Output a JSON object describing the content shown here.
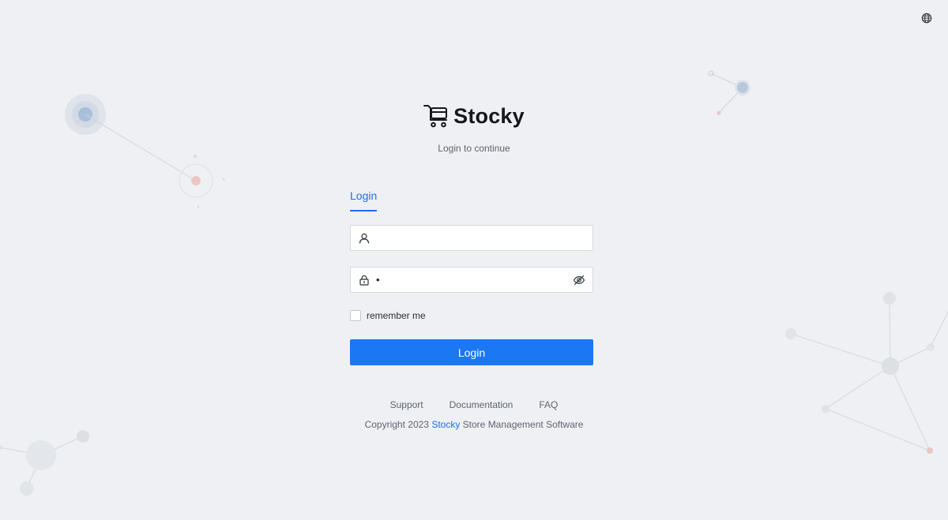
{
  "header": {
    "language_icon": "globe-icon"
  },
  "brand": {
    "logo_icon": "shopping-cart-icon",
    "name": "Stocky",
    "subtitle": "Login to continue"
  },
  "login_form": {
    "tab_label": "Login",
    "username": {
      "icon": "user-icon",
      "value": "",
      "placeholder": ""
    },
    "password": {
      "icon": "lock-icon",
      "value": "•",
      "placeholder": "",
      "toggle_icon": "eye-slash-icon"
    },
    "remember_label": "remember me",
    "remember_checked": false,
    "submit_label": "Login"
  },
  "footer": {
    "links": [
      "Support",
      "Documentation",
      "FAQ"
    ],
    "copyright_prefix": "Copyright  2023",
    "copyright_brand": "Stocky",
    "copyright_suffix": "Store Management Software"
  },
  "colors": {
    "accent": "#1b77f2",
    "background": "#eef0f3"
  }
}
